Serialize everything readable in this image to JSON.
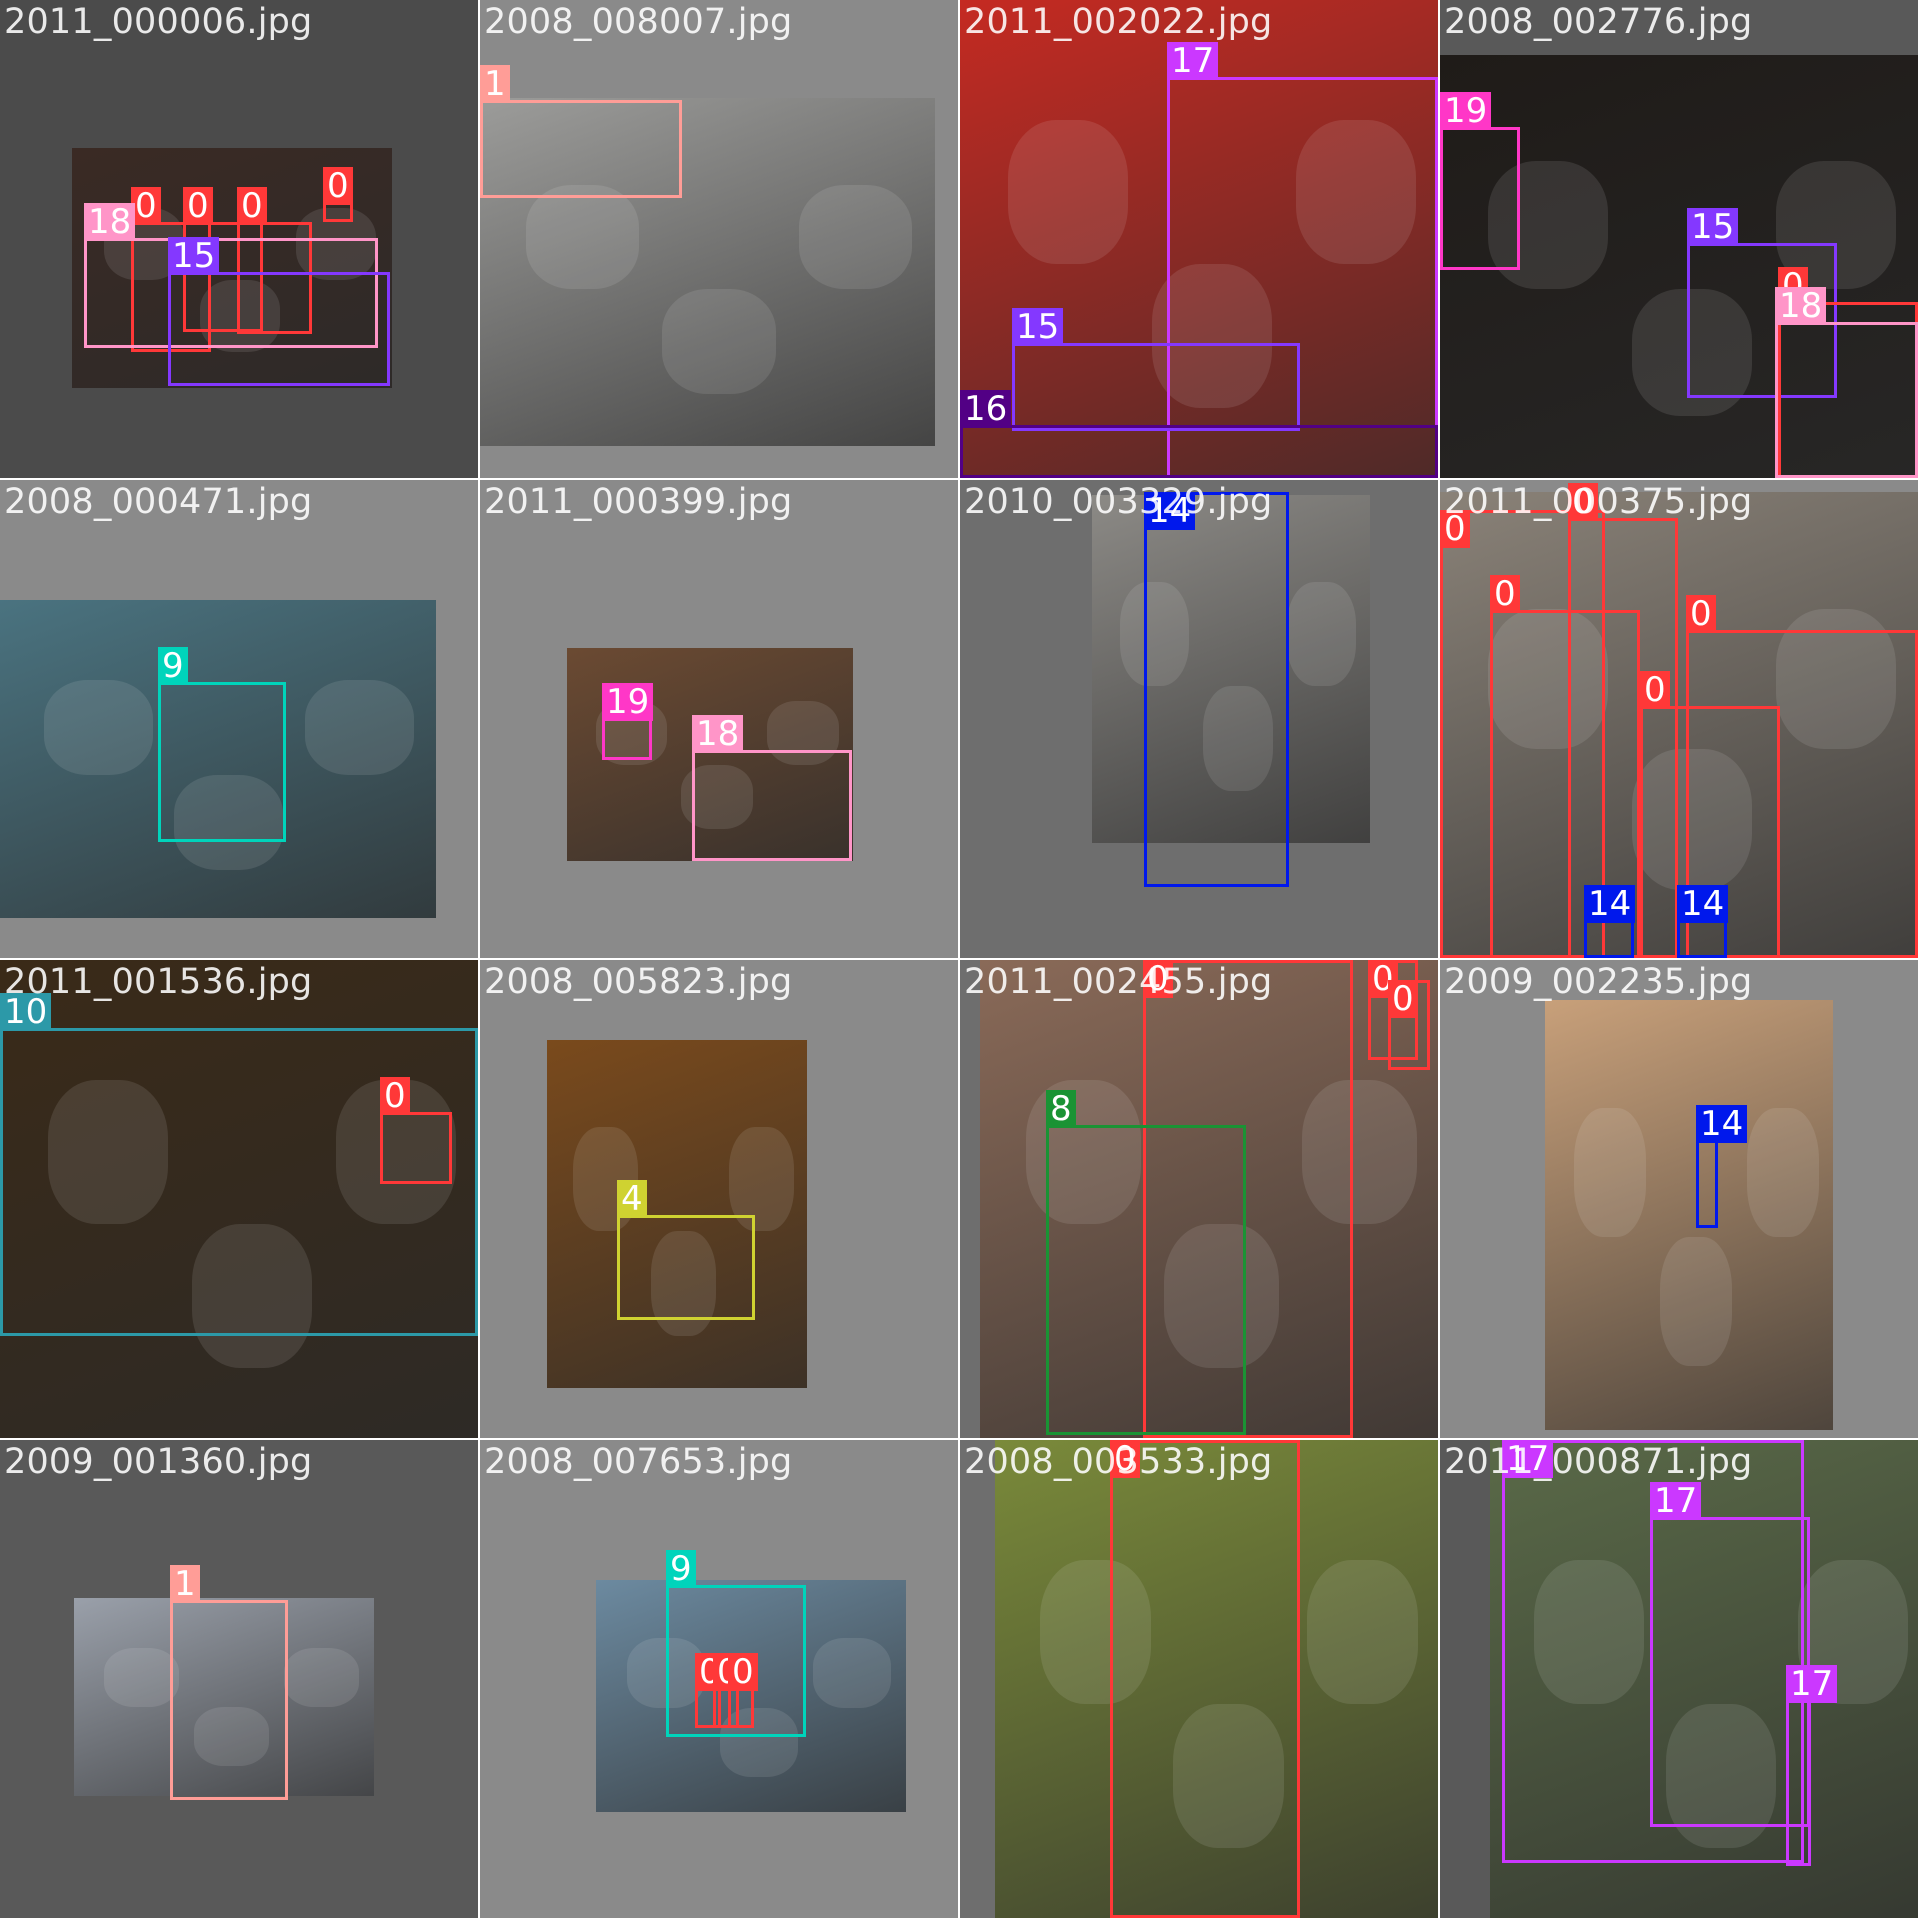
{
  "colors": {
    "0": "#ff3838",
    "1": "#ff9d97",
    "4": "#cfd231",
    "8": "#1a9334",
    "9": "#00d4bb",
    "10": "#2c99a8",
    "14": "#0018ec",
    "15": "#8438ff",
    "16": "#520085",
    "17": "#cb38ff",
    "18": "#ff95c8",
    "19": "#ff37c7"
  },
  "tiles": [
    {
      "filename": "2011_000006.jpg",
      "bg": "#4b4b4b",
      "photo_bg": "#3a2a24",
      "labels": [
        "0",
        "0",
        "0",
        "0",
        "18",
        "15"
      ]
    },
    {
      "filename": "2008_008007.jpg",
      "bg": "#8a8a8a",
      "photo_bg": "#9c9c9a",
      "labels": [
        "1"
      ]
    },
    {
      "filename": "2011_002022.jpg",
      "bg": "#c52a22",
      "photo_bg": "#c52a22",
      "labels": [
        "17",
        "15",
        "16"
      ]
    },
    {
      "filename": "2008_002776.jpg",
      "bg": "#595959",
      "photo_bg": "#1f1b18",
      "labels": [
        "19",
        "15",
        "0",
        "18"
      ]
    },
    {
      "filename": "2008_000471.jpg",
      "bg": "#8a8a8a",
      "photo_bg": "#4a7380",
      "labels": [
        "9"
      ]
    },
    {
      "filename": "2011_000399.jpg",
      "bg": "#8a8a8a",
      "photo_bg": "#6b4a32",
      "labels": [
        "19",
        "18"
      ]
    },
    {
      "filename": "2010_003329.jpg",
      "bg": "#6e6e6e",
      "photo_bg": "#8c8a86",
      "labels": [
        "14"
      ]
    },
    {
      "filename": "2011_000375.jpg",
      "bg": "#8a8a8a",
      "photo_bg": "#8a8278",
      "labels": [
        "0",
        "0",
        "0",
        "0",
        "0",
        "14",
        "14"
      ]
    },
    {
      "filename": "2011_001536.jpg",
      "bg": "#4b3a22",
      "photo_bg": "#3a2a18",
      "labels": [
        "10",
        "0"
      ]
    },
    {
      "filename": "2008_005823.jpg",
      "bg": "#8a8a8a",
      "photo_bg": "#7a4a1c",
      "labels": [
        "4"
      ]
    },
    {
      "filename": "2011_002455.jpg",
      "bg": "#6e6e6e",
      "photo_bg": "#8a6a58",
      "labels": [
        "0",
        "0",
        "0",
        "8"
      ]
    },
    {
      "filename": "2009_002235.jpg",
      "bg": "#8a8a8a",
      "photo_bg": "#c8a07a",
      "labels": [
        "14"
      ]
    },
    {
      "filename": "2009_001360.jpg",
      "bg": "#595959",
      "photo_bg": "#9aa0aa",
      "labels": [
        "1"
      ]
    },
    {
      "filename": "2008_007653.jpg",
      "bg": "#8a8a8a",
      "photo_bg": "#6c8aa0",
      "labels": [
        "9",
        "0",
        "0",
        "0"
      ]
    },
    {
      "filename": "2008_003533.jpg",
      "bg": "#6e6e6e",
      "photo_bg": "#7a8a3a",
      "labels": [
        "0"
      ]
    },
    {
      "filename": "2011_000871.jpg",
      "bg": "#595959",
      "photo_bg": "#5a6a48",
      "labels": [
        "17",
        "17",
        "17"
      ]
    }
  ]
}
